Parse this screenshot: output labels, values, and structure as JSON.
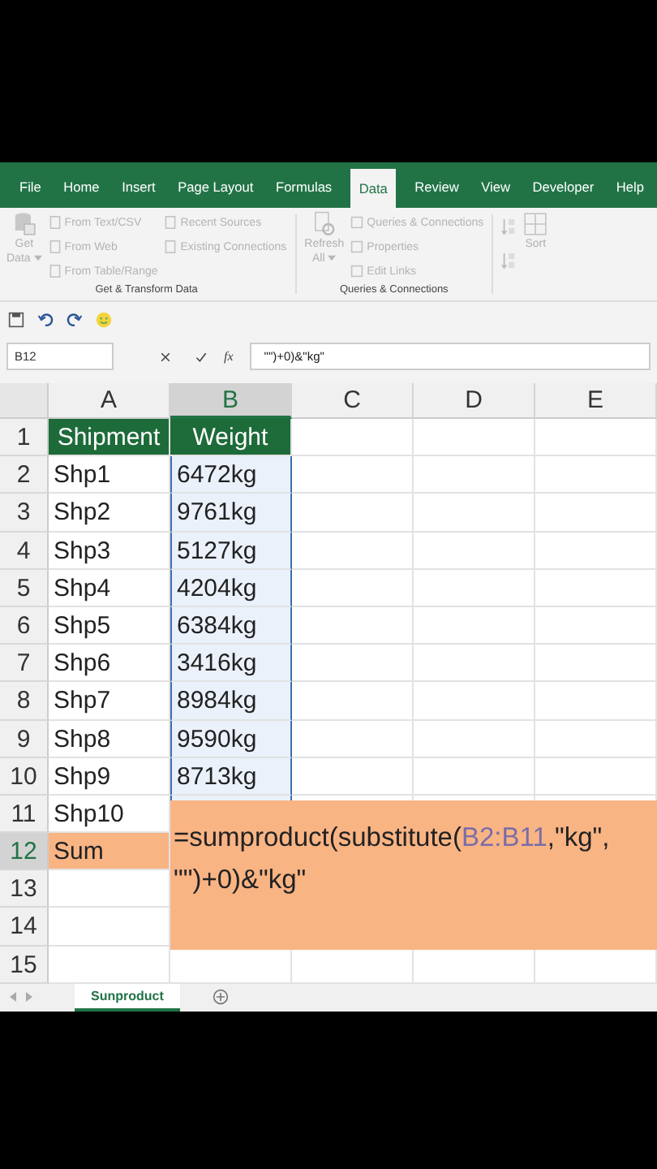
{
  "ribbon_tabs": [
    {
      "label": "File",
      "selected": false
    },
    {
      "label": "Home",
      "selected": false
    },
    {
      "label": "Insert",
      "selected": false
    },
    {
      "label": "Page Layout",
      "selected": false
    },
    {
      "label": "Formulas",
      "selected": false
    },
    {
      "label": "Data",
      "selected": true
    },
    {
      "label": "Review",
      "selected": false
    },
    {
      "label": "View",
      "selected": false
    },
    {
      "label": "Developer",
      "selected": false
    },
    {
      "label": "Help",
      "selected": false
    }
  ],
  "ribbon": {
    "get_transform": {
      "big_button": {
        "line1": "Get",
        "line2": "Data",
        "disabled": true
      },
      "column_1": [
        {
          "label": "From Text/CSV",
          "disabled": true
        },
        {
          "label": "From Web",
          "disabled": true
        },
        {
          "label": "From Table/Range",
          "disabled": true
        }
      ],
      "column_2": [
        {
          "label": "Recent Sources",
          "disabled": true
        },
        {
          "label": "Existing Connections",
          "disabled": true
        }
      ],
      "group_label": "Get & Transform Data"
    },
    "queries": {
      "big_button": {
        "line1": "Refresh",
        "line2": "All",
        "disabled": true
      },
      "items": [
        {
          "label": "Queries & Connections",
          "disabled": true
        },
        {
          "label": "Properties",
          "disabled": true
        },
        {
          "label": "Edit Links",
          "disabled": true
        }
      ],
      "group_label": "Queries & Connections"
    },
    "sort": {
      "label": "Sort",
      "disabled": true
    }
  },
  "formula_bar": {
    "name_box": "B12",
    "function_label": "fx",
    "formula": "\"\")+0)&\"kg\""
  },
  "columns": [
    {
      "label": "A",
      "selected": false
    },
    {
      "label": "B",
      "selected": true
    },
    {
      "label": "C",
      "selected": false
    },
    {
      "label": "D",
      "selected": false
    },
    {
      "label": "E",
      "selected": false
    }
  ],
  "rows": [
    {
      "number": "1",
      "selected": false,
      "cells": [
        {
          "text": "Shipment",
          "kind": "header",
          "selected": false
        },
        {
          "text": "Weight",
          "kind": "header",
          "selected": false
        }
      ]
    },
    {
      "number": "2",
      "selected": false,
      "cells": [
        {
          "text": "Shp1",
          "kind": "plain",
          "selected": false
        },
        {
          "text": "6472kg",
          "kind": "plain",
          "selected": true
        }
      ]
    },
    {
      "number": "3",
      "selected": false,
      "cells": [
        {
          "text": "Shp2",
          "kind": "plain",
          "selected": false
        },
        {
          "text": "9761kg",
          "kind": "plain",
          "selected": true
        }
      ]
    },
    {
      "number": "4",
      "selected": false,
      "cells": [
        {
          "text": "Shp3",
          "kind": "plain",
          "selected": false
        },
        {
          "text": "5127kg",
          "kind": "plain",
          "selected": true
        }
      ]
    },
    {
      "number": "5",
      "selected": false,
      "cells": [
        {
          "text": "Shp4",
          "kind": "plain",
          "selected": false
        },
        {
          "text": "4204kg",
          "kind": "plain",
          "selected": true
        }
      ]
    },
    {
      "number": "6",
      "selected": false,
      "cells": [
        {
          "text": "Shp5",
          "kind": "plain",
          "selected": false
        },
        {
          "text": "6384kg",
          "kind": "plain",
          "selected": true
        }
      ]
    },
    {
      "number": "7",
      "selected": false,
      "cells": [
        {
          "text": "Shp6",
          "kind": "plain",
          "selected": false
        },
        {
          "text": "3416kg",
          "kind": "plain",
          "selected": true
        }
      ]
    },
    {
      "number": "8",
      "selected": false,
      "cells": [
        {
          "text": "Shp7",
          "kind": "plain",
          "selected": false
        },
        {
          "text": "8984kg",
          "kind": "plain",
          "selected": true
        }
      ]
    },
    {
      "number": "9",
      "selected": false,
      "cells": [
        {
          "text": "Shp8",
          "kind": "plain",
          "selected": false
        },
        {
          "text": "9590kg",
          "kind": "plain",
          "selected": true
        }
      ]
    },
    {
      "number": "10",
      "selected": false,
      "cells": [
        {
          "text": "Shp9",
          "kind": "plain",
          "selected": false
        },
        {
          "text": "8713kg",
          "kind": "plain",
          "selected": true
        }
      ]
    },
    {
      "number": "11",
      "selected": false,
      "cells": [
        {
          "text": "Shp10",
          "kind": "plain",
          "selected": false
        },
        {
          "text": "",
          "kind": "plain",
          "selected": true
        }
      ]
    },
    {
      "number": "12",
      "selected": true,
      "cells": [
        {
          "text": "Sum",
          "kind": "highlight",
          "selected": false
        }
      ]
    },
    {
      "number": "13",
      "selected": false,
      "cells": []
    },
    {
      "number": "14",
      "selected": false,
      "cells": []
    },
    {
      "number": "15",
      "selected": false,
      "cells": []
    }
  ],
  "cell_editor": {
    "before": "=sumproduct(substitute(",
    "reference": "B2:B11",
    "after": ",\"kg\",",
    "line2": "\"\")+0)&\"kg\""
  },
  "sheet_tabs": [
    {
      "label": "Sunproduct",
      "selected": true
    }
  ]
}
